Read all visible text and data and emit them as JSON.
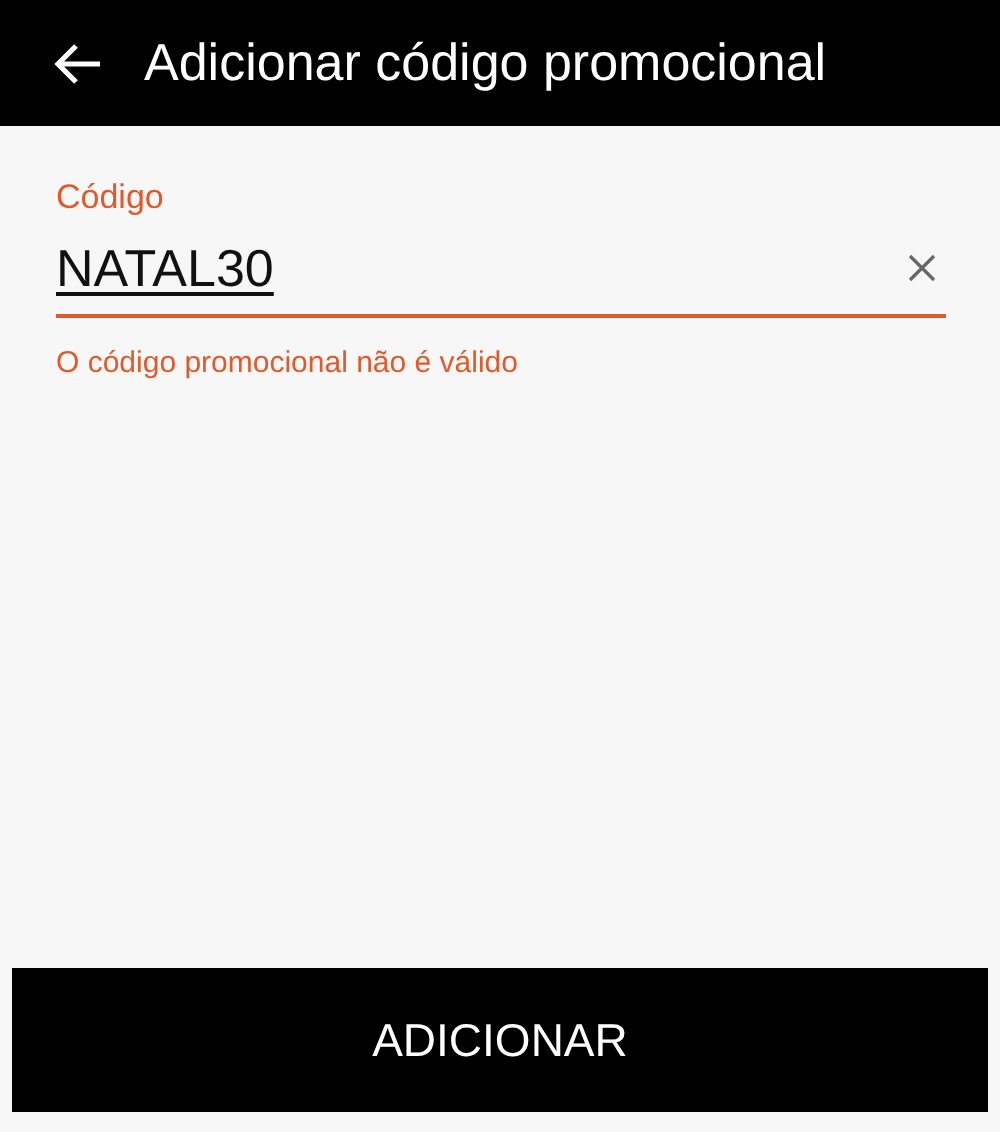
{
  "header": {
    "title": "Adicionar código promocional"
  },
  "promo_field": {
    "label": "Código",
    "value": "NATAL30",
    "error": "O código promocional não é válido"
  },
  "button": {
    "label": "ADICIONAR"
  }
}
